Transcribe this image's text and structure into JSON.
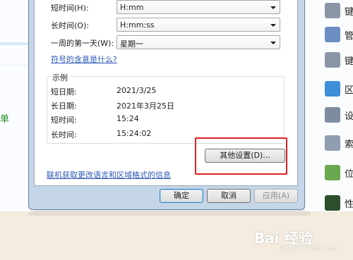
{
  "background": {
    "left_link_text": "单",
    "right_panel_items": [
      {
        "char": "键",
        "icon": "keyboard-icon",
        "color": "#8a96a6"
      },
      {
        "char": "管",
        "icon": "admin-tools-icon",
        "color": "#6b8fc2"
      },
      {
        "char": "键",
        "icon": "keyboard-icon",
        "color": "#8a96a6"
      },
      {
        "char": "区",
        "icon": "region-globe-icon",
        "color": "#3f8ed8"
      },
      {
        "char": "设",
        "icon": "device-manager-icon",
        "color": "#7d8d9f"
      },
      {
        "char": "索",
        "icon": "indexing-icon",
        "color": "#8e9db0"
      },
      {
        "char": "位",
        "icon": "location-icon",
        "color": "#6aa84f"
      },
      {
        "char": "性",
        "icon": "performance-icon",
        "color": "#2d4f2d"
      }
    ]
  },
  "dialog": {
    "rows": [
      {
        "label": "短时间(H):",
        "value": "H:mm"
      },
      {
        "label": "长时间(O):",
        "value": "H:mm:ss"
      },
      {
        "label": "一周的第一天(W):",
        "value": "星期一"
      }
    ],
    "what_link": "符号的含意是什么?",
    "example_title": "示例",
    "examples": [
      {
        "label": "短日期:",
        "value": "2021/3/25"
      },
      {
        "label": "长日期:",
        "value": "2021年3月25日"
      },
      {
        "label": "短时间:",
        "value": "15:24"
      },
      {
        "label": "长时间:",
        "value": "15:24:02"
      }
    ],
    "other_settings_button": "其他设置(D)...",
    "online_link": "联机获取更改语言和区域格式的信息",
    "ok_button": "确定",
    "cancel_button": "取消",
    "apply_button": "应用(A)"
  },
  "watermark": {
    "main": "Bai 经验",
    "sub": "jingyan.baidu.com"
  },
  "colors": {
    "highlight": "#e02020",
    "link": "#2b57b5"
  }
}
